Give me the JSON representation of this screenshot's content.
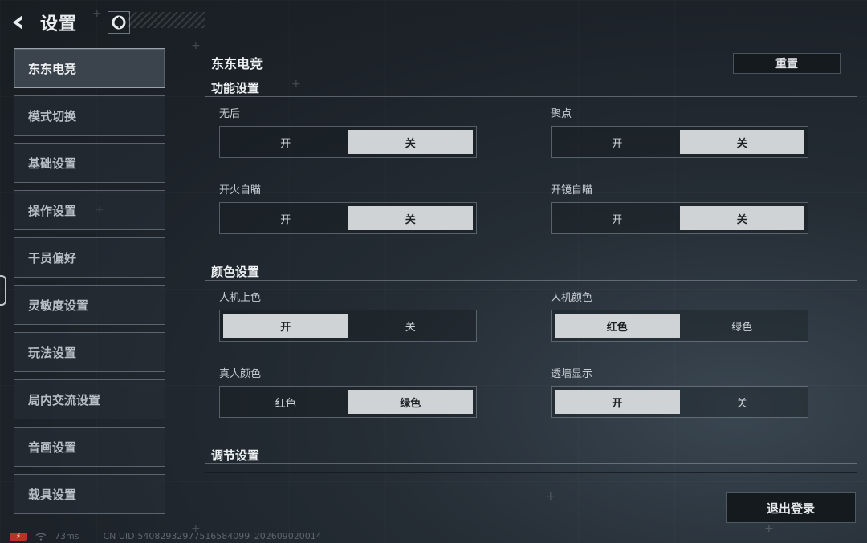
{
  "header": {
    "title": "设置"
  },
  "sidebar": {
    "items": [
      {
        "label": "东东电竞",
        "active": true
      },
      {
        "label": "模式切换"
      },
      {
        "label": "基础设置"
      },
      {
        "label": "操作设置"
      },
      {
        "label": "干员偏好"
      },
      {
        "label": "灵敏度设置"
      },
      {
        "label": "玩法设置"
      },
      {
        "label": "局内交流设置"
      },
      {
        "label": "音画设置"
      },
      {
        "label": "载具设置"
      }
    ]
  },
  "main": {
    "title": "东东电竞",
    "reset_label": "重置",
    "sections": [
      {
        "title": "功能设置",
        "fields": [
          {
            "label": "无后",
            "options": [
              "开",
              "关"
            ],
            "selected": 1
          },
          {
            "label": "聚点",
            "options": [
              "开",
              "关"
            ],
            "selected": 1
          },
          {
            "label": "开火自瞄",
            "options": [
              "开",
              "关"
            ],
            "selected": 1
          },
          {
            "label": "开镜自瞄",
            "options": [
              "开",
              "关"
            ],
            "selected": 1
          }
        ]
      },
      {
        "title": "颜色设置",
        "fields": [
          {
            "label": "人机上色",
            "options": [
              "开",
              "关"
            ],
            "selected": 0
          },
          {
            "label": "人机颜色",
            "options": [
              "红色",
              "绿色"
            ],
            "selected": 0
          },
          {
            "label": "真人颜色",
            "options": [
              "红色",
              "绿色"
            ],
            "selected": 1
          },
          {
            "label": "透墙显示",
            "options": [
              "开",
              "关"
            ],
            "selected": 0
          }
        ]
      },
      {
        "title": "调节设置",
        "fields": []
      }
    ]
  },
  "logout_label": "退出登录",
  "status": {
    "ping": "73ms",
    "uid": "CN UID:54082932977516584099_202609020014"
  },
  "colors": {
    "selected_bg": "#d0d3d6",
    "battery": "#b8322c"
  }
}
